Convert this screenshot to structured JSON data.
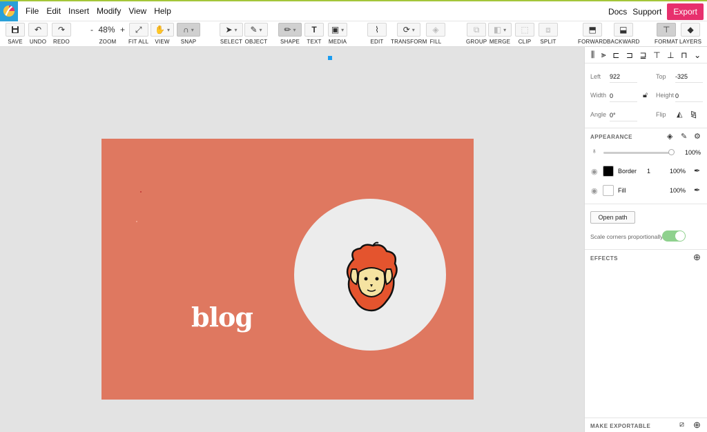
{
  "menu": {
    "items": [
      "File",
      "Edit",
      "Insert",
      "Modify",
      "View",
      "Help"
    ],
    "docs": "Docs",
    "support": "Support",
    "export": "Export"
  },
  "toolbar": {
    "save": "SAVE",
    "undo": "UNDO",
    "redo": "REDO",
    "zoom_label": "ZOOM",
    "zoom_value": "48%",
    "zoom_minus": "-",
    "zoom_plus": "+",
    "fit_all": "FIT ALL",
    "view": "VIEW",
    "snap": "SNAP",
    "select": "SELECT",
    "object": "OBJECT",
    "shape": "SHAPE",
    "text": "TEXT",
    "media": "MEDIA",
    "edit": "EDIT",
    "transform": "TRANSFORM",
    "fill": "FILL",
    "group": "GROUP",
    "merge": "MERGE",
    "clip": "CLIP",
    "split": "SPLIT",
    "forward": "FORWARD",
    "backward": "BACKWARD",
    "format": "FORMAT",
    "layers": "LAYERS"
  },
  "canvas": {
    "blog_text": "blog",
    "artboard_color": "#df7860",
    "circle_color": "#ececec"
  },
  "panel": {
    "left_label": "Left",
    "left_value": "922",
    "top_label": "Top",
    "top_value": "-325",
    "width_label": "Width",
    "width_value": "0",
    "height_label": "Height",
    "height_value": "0",
    "angle_label": "Angle",
    "angle_value": "0°",
    "flip_label": "Flip",
    "appearance_title": "APPEARANCE",
    "opacity_value": "100%",
    "border_label": "Border",
    "border_width": "1",
    "border_opacity": "100%",
    "fill_label": "Fill",
    "fill_opacity": "100%",
    "open_path": "Open path",
    "scale_corners": "Scale corners proportionally",
    "effects_title": "EFFECTS",
    "make_exportable": "MAKE EXPORTABLE"
  },
  "colors": {
    "export_bg": "#e7306d",
    "toggle_on": "#8fd18e",
    "selection_handle": "#1a9cf0"
  }
}
